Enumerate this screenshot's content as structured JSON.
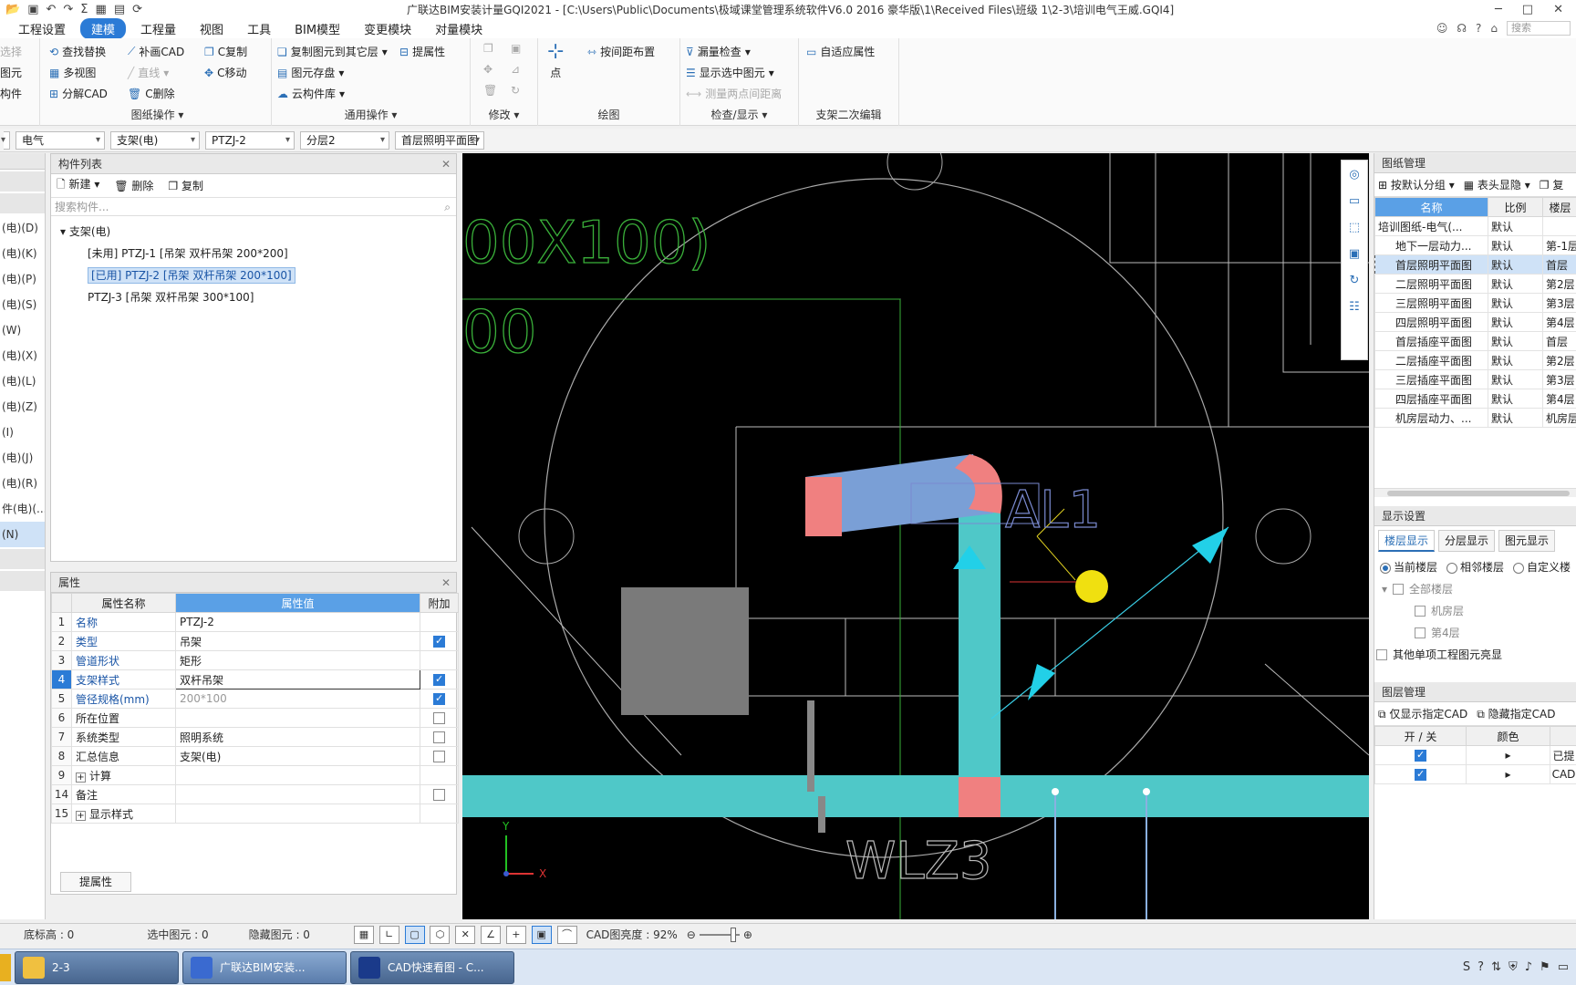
{
  "title": "广联达BIM安装计量GQI2021 - [C:\\Users\\Public\\Documents\\极域课堂管理系统软件V6.0 2016 豪华版\\1\\Received Files\\班级 1\\2-3\\培训电气王威.GQI4]",
  "menu": {
    "tabs": [
      "工程设置",
      "建模",
      "工程量",
      "视图",
      "工具",
      "BIM模型",
      "变更模块",
      "对量模块"
    ],
    "search_placeholder": "搜索"
  },
  "ribbon": {
    "left_cut": [
      "选择",
      "图元",
      "构件"
    ],
    "drawing_ops": {
      "items": [
        "查找替换",
        "补画CAD",
        "C复制",
        "多视图",
        "直线",
        "C移动",
        "分解CAD",
        "C删除"
      ],
      "title": "图纸操作"
    },
    "general_ops": {
      "items": [
        "复制图元到其它层",
        "提属性",
        "图元存盘",
        "云构件库"
      ],
      "title": "通用操作"
    },
    "modify": {
      "title": "修改"
    },
    "draw": {
      "point": "点",
      "interval": "按间距布置",
      "title": "绘图"
    },
    "check": {
      "items": [
        "漏量检查",
        "显示选中图元",
        "测量两点间距离"
      ],
      "title": "检查/显示"
    },
    "bracket": {
      "item": "自适应属性",
      "title": "支架二次编辑"
    }
  },
  "selectors": [
    "电气",
    "支架(电)",
    "PTZJ-2",
    "分层2",
    "首层照明平面图"
  ],
  "left_narrow": {
    "items": [
      "(电)(D)",
      "(电)(K)",
      "(电)(P)",
      "(电)(S)",
      "(W)",
      "(电)(X)",
      "(电)(L)",
      "(电)(Z)",
      "(I)",
      "(电)(J)",
      "(电)(R)",
      "件(电)(...",
      "(N)"
    ]
  },
  "component_list": {
    "title": "构件列表",
    "new": "新建",
    "delete": "删除",
    "copy": "复制",
    "search_placeholder": "搜索构件...",
    "root": "支架(电)",
    "items": [
      "[未用] PTZJ-1 [吊架 双杆吊架 200*200]",
      "[已用] PTZJ-2 [吊架 双杆吊架 200*100]",
      "PTZJ-3 [吊架 双杆吊架 300*100]"
    ]
  },
  "properties": {
    "title": "属性",
    "headers": [
      "属性名称",
      "属性值",
      "附加"
    ],
    "rows": [
      {
        "num": "1",
        "name": "名称",
        "value": "PTZJ-2"
      },
      {
        "num": "2",
        "name": "类型",
        "value": "吊架"
      },
      {
        "num": "3",
        "name": "管道形状",
        "value": "矩形"
      },
      {
        "num": "4",
        "name": "支架样式",
        "value": "双杆吊架"
      },
      {
        "num": "5",
        "name": "管径规格(mm)",
        "value": "200*100"
      },
      {
        "num": "6",
        "name": "所在位置",
        "value": ""
      },
      {
        "num": "7",
        "name": "系统类型",
        "value": "照明系统"
      },
      {
        "num": "8",
        "name": "汇总信息",
        "value": "支架(电)"
      },
      {
        "num": "9",
        "name": "计算",
        "value": ""
      },
      {
        "num": "14",
        "name": "备注",
        "value": ""
      },
      {
        "num": "15",
        "name": "显示样式",
        "value": ""
      }
    ],
    "extract_button": "提属性"
  },
  "canvas": {
    "text_top": "00X100)",
    "text_top2": "00",
    "label_al": "AL1",
    "label_wlz": "WLZ3",
    "axis_x": "X",
    "axis_y": "Y"
  },
  "drawing_mgmt": {
    "title": "图纸管理",
    "group_btn": "按默认分组",
    "header_btn": "表头显隐",
    "copy_btn": "复",
    "headers": [
      "名称",
      "比例",
      "楼层"
    ],
    "rows": [
      {
        "name": "培训图纸-电气(...",
        "scale": "默认",
        "floor": ""
      },
      {
        "name": "地下一层动力...",
        "scale": "默认",
        "floor": "第-1层"
      },
      {
        "name": "首层照明平面图",
        "scale": "默认",
        "floor": "首层"
      },
      {
        "name": "二层照明平面图",
        "scale": "默认",
        "floor": "第2层"
      },
      {
        "name": "三层照明平面图",
        "scale": "默认",
        "floor": "第3层"
      },
      {
        "name": "四层照明平面图",
        "scale": "默认",
        "floor": "第4层"
      },
      {
        "name": "首层插座平面图",
        "scale": "默认",
        "floor": "首层"
      },
      {
        "name": "二层插座平面图",
        "scale": "默认",
        "floor": "第2层"
      },
      {
        "name": "三层插座平面图",
        "scale": "默认",
        "floor": "第3层"
      },
      {
        "name": "四层插座平面图",
        "scale": "默认",
        "floor": "第4层"
      },
      {
        "name": "机房层动力、...",
        "scale": "默认",
        "floor": "机房层"
      }
    ]
  },
  "display_settings": {
    "title": "显示设置",
    "tabs": [
      "楼层显示",
      "分层显示",
      "图元显示"
    ],
    "radios": [
      "当前楼层",
      "相邻楼层",
      "自定义楼"
    ],
    "tree": [
      "全部楼层",
      "机房层",
      "第4层"
    ],
    "other": "其他单项工程图元亮显"
  },
  "layer_mgmt": {
    "title": "图层管理",
    "show_btn": "仅显示指定CAD",
    "hide_btn": "隐藏指定CAD",
    "headers": [
      "开 / 关",
      "颜色",
      ""
    ],
    "rows": [
      {
        "col3": "已提"
      },
      {
        "col3": "CAD"
      }
    ]
  },
  "status": {
    "base_height": "底标高 : 0",
    "selected": "选中图元 : 0",
    "hidden": "隐藏图元 : 0",
    "cad_brightness": "CAD图亮度 : 92%"
  },
  "taskbar": {
    "items": [
      "2-3",
      "广联达BIM安装...",
      "CAD快速看图 - C..."
    ]
  },
  "colors": {
    "accent": "#2b7bd6",
    "tray_teal": "#4fc8c8",
    "bracket_blue": "#7a9fd6",
    "bracket_pink": "#f08080",
    "cad_green": "#3ab03a"
  }
}
